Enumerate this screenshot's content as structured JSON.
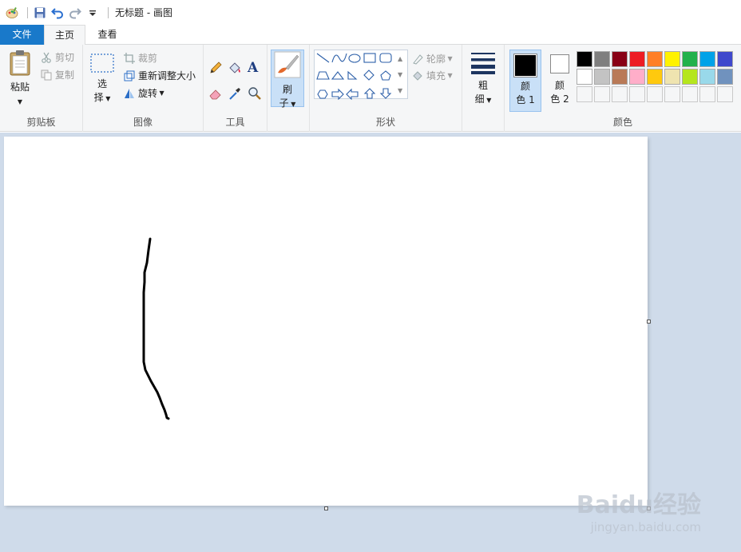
{
  "window": {
    "title": "无标题 - 画图"
  },
  "tabs": {
    "file": "文件",
    "home": "主页",
    "view": "查看"
  },
  "clipboard": {
    "paste": "粘贴",
    "cut": "剪切",
    "copy": "复制",
    "label": "剪贴板"
  },
  "image": {
    "select_line1": "选",
    "select_line2": "择",
    "crop": "裁剪",
    "resize": "重新调整大小",
    "rotate": "旋转",
    "label": "图像"
  },
  "tools": {
    "label": "工具",
    "text_icon": "A"
  },
  "brushes": {
    "line1": "刷",
    "line2": "子"
  },
  "shapes": {
    "outline": "轮廓",
    "fill": "填充",
    "label": "形状"
  },
  "size": {
    "line1": "粗",
    "line2": "细"
  },
  "colors": {
    "color1_line1": "颜",
    "color1_line2": "色 1",
    "color2_line1": "颜",
    "color2_line2": "色 2",
    "label": "颜色",
    "color1": "#000000",
    "color2": "#ffffff",
    "palette_row1": [
      "#000000",
      "#7f7f7f",
      "#880015",
      "#ed1c24",
      "#ff7f27",
      "#fff200",
      "#22b14c",
      "#00a2e8",
      "#3f48cc",
      "#a349a4"
    ],
    "palette_row2": [
      "#ffffff",
      "#c3c3c3",
      "#b97a57",
      "#ffaec9",
      "#ffc90e",
      "#efe4b0",
      "#b5e61d",
      "#99d9ea",
      "#7092be",
      "#c8bfe7"
    ]
  },
  "watermark": {
    "logo": "Baidu经验",
    "url": "jingyan.baidu.com"
  }
}
